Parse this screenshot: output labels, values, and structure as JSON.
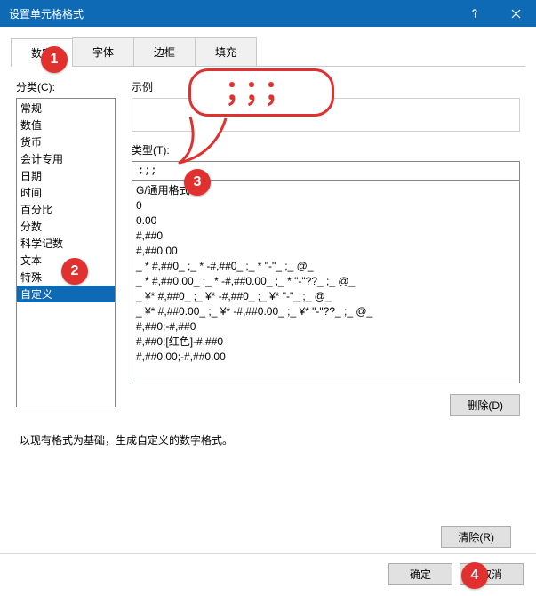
{
  "window": {
    "title": "设置单元格格式"
  },
  "tabs": {
    "number": "数字",
    "font": "字体",
    "border": "边框",
    "fill": "填充"
  },
  "category": {
    "label": "分类(C):",
    "items": [
      "常规",
      "数值",
      "货币",
      "会计专用",
      "日期",
      "时间",
      "百分比",
      "分数",
      "科学记数",
      "文本",
      "特殊",
      "自定义"
    ],
    "selected": "自定义"
  },
  "sample": {
    "label": "示例"
  },
  "type": {
    "label": "类型(T):",
    "value": ";;;",
    "list": [
      "G/通用格式",
      "0",
      "0.00",
      "#,##0",
      "#,##0.00",
      "_ * #,##0_ ;_ * -#,##0_ ;_ * \"-\"_ ;_ @_ ",
      "_ * #,##0.00_ ;_ * -#,##0.00_ ;_ * \"-\"??_ ;_ @_ ",
      "_ ¥* #,##0_ ;_ ¥* -#,##0_ ;_ ¥* \"-\"_ ;_ @_ ",
      "_ ¥* #,##0.00_ ;_ ¥* -#,##0.00_ ;_ ¥* \"-\"??_ ;_ @_ ",
      "#,##0;-#,##0",
      "#,##0;[红色]-#,##0",
      "#,##0.00;-#,##0.00"
    ]
  },
  "buttons": {
    "delete": "删除(D)",
    "clear": "清除(R)",
    "ok": "确定",
    "cancel": "取消"
  },
  "hint": "以现有格式为基础，生成自定义的数字格式。",
  "annotation": {
    "speech": "；；；",
    "badges": {
      "b1": "1",
      "b2": "2",
      "b3": "3",
      "b4": "4"
    }
  }
}
